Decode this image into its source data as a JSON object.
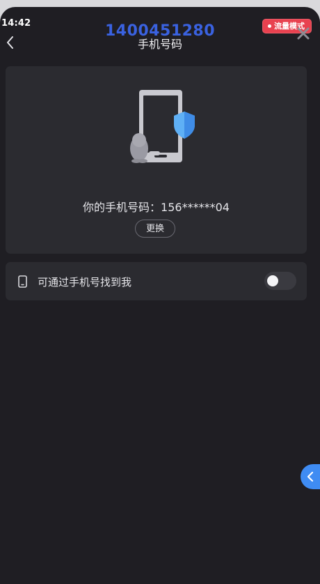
{
  "status_bar": {
    "time": "14:42"
  },
  "overlay": {
    "account_number": "1400451280",
    "flow_badge_label": "流量模式"
  },
  "header": {
    "title": "手机号码",
    "back_icon": "chevron-left-icon",
    "close_icon": "close-icon"
  },
  "phone_card": {
    "illustration": "phone-shield-penguin-illustration",
    "phone_number_text": "你的手机号码：156******04",
    "change_button_label": "更换"
  },
  "findable_row": {
    "icon": "mobile-phone-icon",
    "label": "可通过手机号找到我",
    "toggle_on": false
  },
  "floating_button": {
    "icon": "chevron-left-icon"
  },
  "colors": {
    "background": "#1f1e23",
    "card": "#2b2b30",
    "account_number": "#3a62e0",
    "badge": "#e8414f",
    "float_button": "#3f8cf3",
    "shield": "#5fb0f5"
  }
}
